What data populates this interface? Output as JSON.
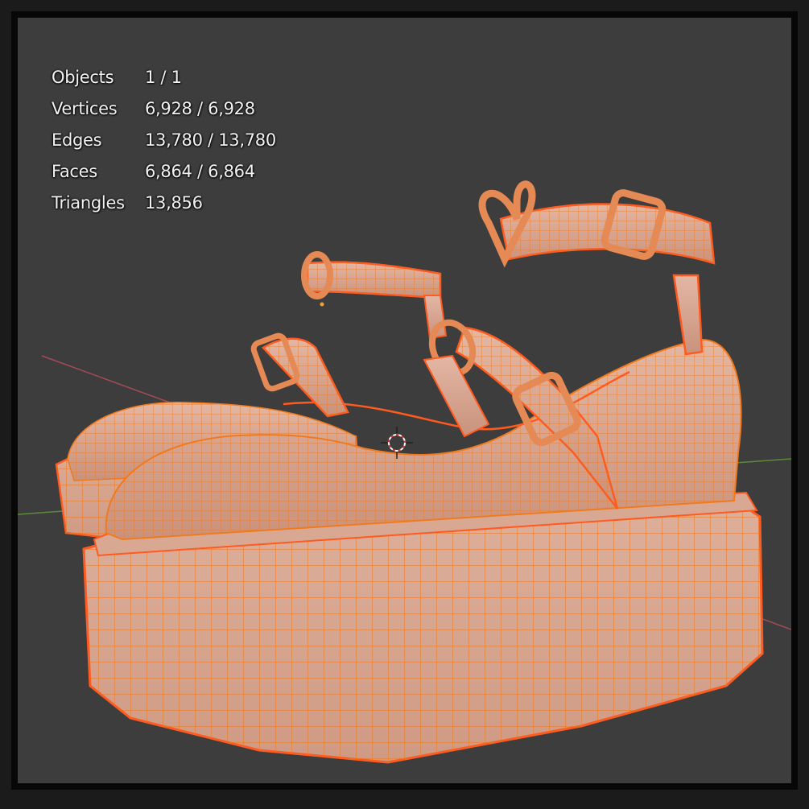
{
  "stats": {
    "rows": [
      {
        "label": "Objects",
        "value": "1 / 1"
      },
      {
        "label": "Vertices",
        "value": "6,928 / 6,928"
      },
      {
        "label": "Edges",
        "value": "13,780 / 13,780"
      },
      {
        "label": "Faces",
        "value": "6,864 / 6,864"
      },
      {
        "label": "Triangles",
        "value": "13,856"
      }
    ]
  },
  "colors": {
    "viewport_bg": "#3d3d3d",
    "mesh_fill": "#d7a58f",
    "wire_orange": "#f07a1e",
    "selection_outline": "#ff5a1f",
    "x_axis": "#a44b56",
    "y_axis": "#5c8a3a"
  },
  "icons": {
    "cursor": "3d-cursor-icon"
  }
}
